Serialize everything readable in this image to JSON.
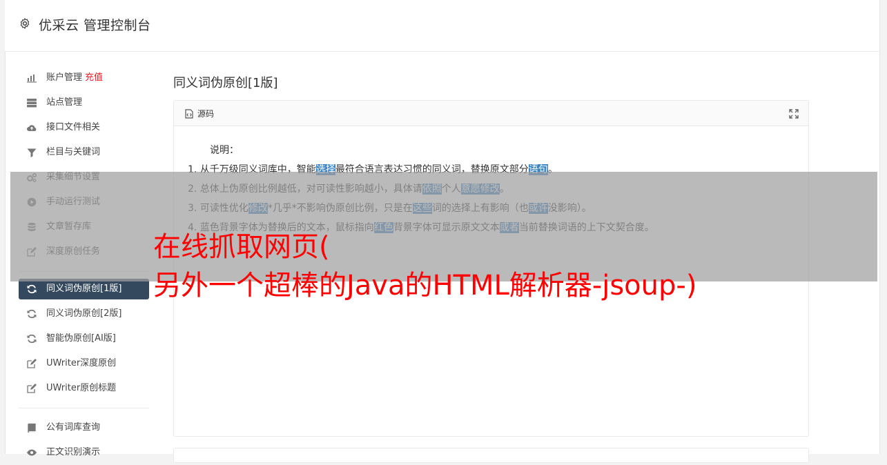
{
  "app": {
    "title": "优采云 管理控制台"
  },
  "sidebar": {
    "group1": [
      {
        "label": "账户管理",
        "badge": "充值",
        "icon": "bar-chart-icon"
      },
      {
        "label": "站点管理",
        "icon": "server-icon"
      },
      {
        "label": "接口文件相关",
        "icon": "cloud-upload-icon"
      },
      {
        "label": "栏目与关键词",
        "icon": "filter-icon"
      },
      {
        "label": "采集细节设置",
        "icon": "cogs-icon"
      },
      {
        "label": "手动运行测试",
        "icon": "play-circle-icon"
      },
      {
        "label": "文章暂存库",
        "icon": "database-icon"
      },
      {
        "label": "深度原创任务",
        "icon": "edit-icon"
      }
    ],
    "group2": [
      {
        "label": "同义词伪原创[1版]",
        "icon": "refresh-icon",
        "active": true
      },
      {
        "label": "同义词伪原创[2版]",
        "icon": "refresh-icon"
      },
      {
        "label": "智能伪原创[AI版]",
        "icon": "refresh-icon"
      },
      {
        "label": "UWriter深度原创",
        "icon": "edit-icon"
      },
      {
        "label": "UWriter原创标题",
        "icon": "edit-icon"
      }
    ],
    "group3": [
      {
        "label": "公有词库查询",
        "icon": "book-icon"
      },
      {
        "label": "正文识别演示",
        "icon": "eye-icon"
      }
    ]
  },
  "main": {
    "title": "同义词伪原创[1版]",
    "panel": {
      "header": "源码",
      "desc_title": "说明：",
      "lines": [
        [
          {
            "t": "1. 从千万级同义词库中，智能"
          },
          {
            "t": "选择",
            "h": true
          },
          {
            "t": "最符合语言表达习惯的同义词，替换原文部分"
          },
          {
            "t": "语句",
            "h": true
          },
          {
            "t": "。"
          }
        ],
        [
          {
            "t": "2. 总体上伪原创比例越低，对可读性影响越小，具体请"
          },
          {
            "t": "依照",
            "h": true
          },
          {
            "t": "个人"
          },
          {
            "t": "意愿",
            "h": true
          },
          {
            "t": "修改",
            "h": true
          },
          {
            "t": "。"
          }
        ],
        [
          {
            "t": "3. 可读性优化"
          },
          {
            "t": "修改",
            "h": true
          },
          {
            "t": "*几乎*不影响伪原创比例，只是在"
          },
          {
            "t": "这些",
            "h": true
          },
          {
            "t": "词的选择上有影响（也"
          },
          {
            "t": "或许",
            "h": true
          },
          {
            "t": "没影响）。"
          }
        ],
        [
          {
            "t": "4. 蓝色背景字体为替换后的文本，鼠标指向"
          },
          {
            "t": "红色",
            "h": true
          },
          {
            "t": "背景字体可显示原文文本"
          },
          {
            "t": "或者",
            "h": true
          },
          {
            "t": "当前替换词语的上下文契合度。"
          }
        ]
      ]
    }
  },
  "overlay": {
    "line1": "在线抓取网页(",
    "line2": "另外一个超棒的Java的HTML解析器-jsoup-)"
  },
  "colors": {
    "active_bg": "#34495e",
    "highlight": "#3d86c6",
    "overlay_text": "#ff0000",
    "badge": "#ed1c24"
  }
}
